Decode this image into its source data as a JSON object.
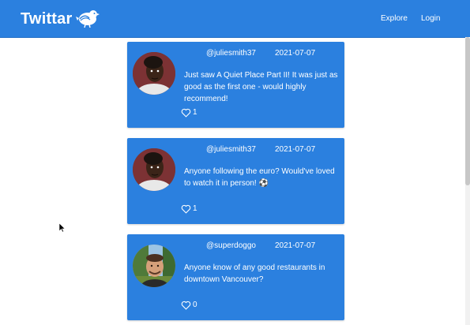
{
  "nav": {
    "brand": "Twittar",
    "links": [
      "Explore",
      "Login"
    ]
  },
  "posts": [
    {
      "username": "@juliesmith37",
      "date": "2021-07-07",
      "text": "Just saw A Quiet Place Part II! It was just as good as the first one - would highly recommend!",
      "likes": "1"
    },
    {
      "username": "@juliesmith37",
      "date": "2021-07-07",
      "text": "Anyone following the euro? Would've loved to watch it in person! ⚽",
      "likes": "1"
    },
    {
      "username": "@superdoggo",
      "date": "2021-07-07",
      "text": "Anyone know of any good restaurants in downtown Vancouver?",
      "likes": "0"
    }
  ],
  "colors": {
    "primary": "#2b80df",
    "text_on_primary": "#ffffff"
  },
  "icons": [
    "bird-icon",
    "heart-icon",
    "cursor-icon"
  ]
}
